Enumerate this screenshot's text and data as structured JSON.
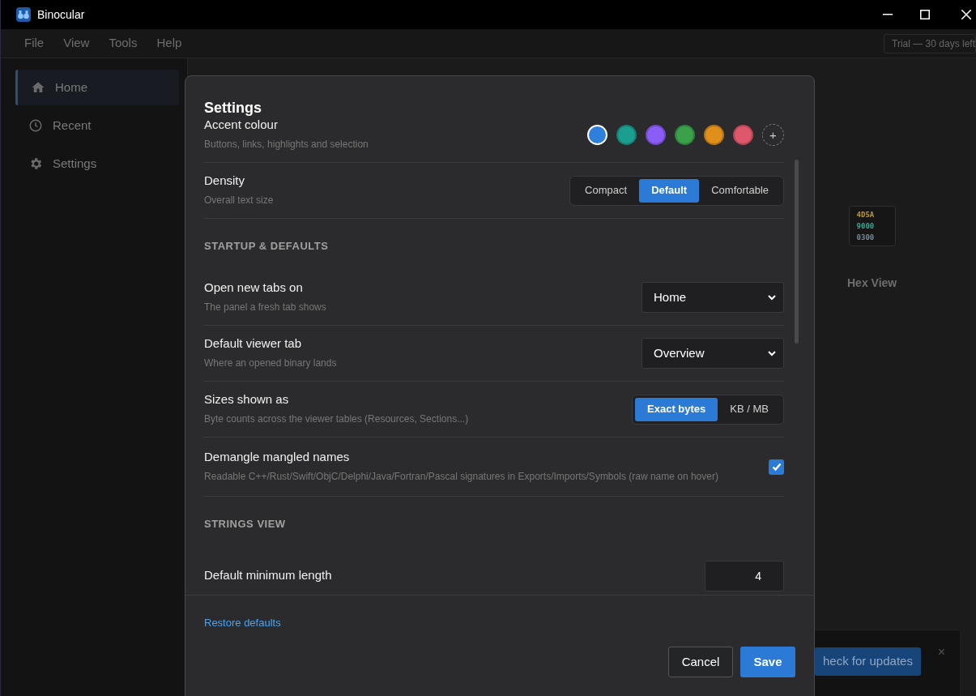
{
  "window": {
    "title": "Binocular"
  },
  "menu": [
    "File",
    "View",
    "Tools",
    "Help"
  ],
  "trial_badge": "Trial — 30 days left",
  "sidebar": {
    "items": [
      {
        "label": "Home",
        "kind": "home",
        "selected": true
      },
      {
        "label": "Recent",
        "kind": "clock",
        "selected": false
      },
      {
        "label": "Settings",
        "kind": "gear",
        "selected": false
      }
    ]
  },
  "hex_card": {
    "label": "Hex View",
    "lines": [
      {
        "text": "4D5A",
        "color": "#b8962e"
      },
      {
        "text": "9000",
        "color": "#3aa58f"
      },
      {
        "text": "0300",
        "color": "#7a8a99"
      }
    ]
  },
  "toast": {
    "button": "heck for updates",
    "close": "×"
  },
  "settings": {
    "title": "Settings",
    "rows": [
      {
        "kind": "swatches",
        "label": "Accent colour",
        "description": "Buttons, links, highlights and selection",
        "add": "+",
        "swatches": [
          {
            "color": "#2f7fdc",
            "selected": true
          },
          {
            "color": "#1a9e8f",
            "selected": false
          },
          {
            "color": "#8b5cf6",
            "selected": false
          },
          {
            "color": "#3aa04a",
            "selected": false
          },
          {
            "color": "#e0901a",
            "selected": false
          },
          {
            "color": "#e0566a",
            "selected": false
          }
        ]
      },
      {
        "kind": "segmented",
        "label": "Density",
        "description": "Overall text size",
        "options": [
          {
            "label": "Compact",
            "selected": false
          },
          {
            "label": "Default",
            "selected": true
          },
          {
            "label": "Comfortable",
            "selected": false
          }
        ]
      },
      {
        "kind": "heading",
        "label": "STARTUP & DEFAULTS"
      },
      {
        "kind": "select",
        "label": "Open new tabs on",
        "description": "The panel a fresh tab shows",
        "value": "Home"
      },
      {
        "kind": "select",
        "label": "Default viewer tab",
        "description": "Where an opened binary lands",
        "value": "Overview"
      },
      {
        "kind": "segmented",
        "label": "Sizes shown as",
        "description": "Byte counts across the viewer tables (Resources, Sections...)",
        "options": [
          {
            "label": "Exact bytes",
            "selected": true
          },
          {
            "label": "KB / MB",
            "selected": false
          }
        ]
      },
      {
        "kind": "checkbox",
        "label": "Demangle mangled names",
        "description": "Readable C++/Rust/Swift/ObjC/Delphi/Java/Fortran/Pascal signatures in Exports/Imports/Symbols (raw name on hover)",
        "checked": true
      },
      {
        "kind": "heading",
        "label": "STRINGS VIEW"
      },
      {
        "kind": "number",
        "label": "Default minimum length",
        "value": "4"
      }
    ],
    "restore": "Restore defaults",
    "cancel": "Cancel",
    "save": "Save"
  }
}
